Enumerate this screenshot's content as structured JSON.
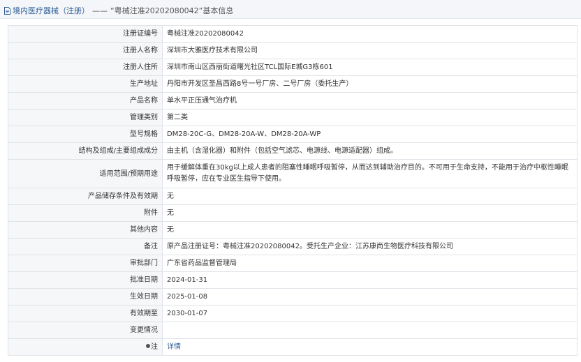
{
  "breadcrumb": {
    "section": "境内医疗器械（注册）",
    "separator": "——",
    "current": "“粤械注准20202080042”基本信息"
  },
  "rows": [
    {
      "label": "注册证编号",
      "value": "粤械注准20202080042"
    },
    {
      "label": "注册人名称",
      "value": "深圳市大雅医疗技术有限公司"
    },
    {
      "label": "注册人住所",
      "value": "深圳市南山区西丽街道曙光社区TCL国际E城G3栋601"
    },
    {
      "label": "生产地址",
      "value": "丹阳市开发区圣昌西路8号一号厂房、二号厂房（委托生产）"
    },
    {
      "label": "产品名称",
      "value": "单水平正压通气治疗机"
    },
    {
      "label": "管理类别",
      "value": "第二类"
    },
    {
      "label": "型号规格",
      "value": "DM28-20C-G、DM28-20A-W、DM28-20A-WP"
    },
    {
      "label": "结构及组成/主要组成成分",
      "value": "由主机（含湿化器）和附件（包括空气滤芯、电源线、电源适配器）组成。"
    },
    {
      "label": "适用范围/预期用途",
      "value": "用于缓解体重在30kg以上成人患者的阻塞性睡眠呼吸暂停，从而达到辅助治疗目的。不可用于生命支持，不能用于治疗中枢性睡眠呼吸暂停，应在专业医生指导下使用。"
    },
    {
      "label": "产品储存条件及有效期",
      "value": "无"
    },
    {
      "label": "附件",
      "value": "无"
    },
    {
      "label": "其他内容",
      "value": "无"
    },
    {
      "label": "备注",
      "value": "原产品注册证号：粤械注准20202080042。受托生产企业：江苏康尚生物医疗科技有限公司"
    },
    {
      "label": "审批部门",
      "value": "广东省药品监督管理局"
    },
    {
      "label": "批准日期",
      "value": "2024-01-31"
    },
    {
      "label": "生效日期",
      "value": "2025-01-08"
    },
    {
      "label": "有效期至",
      "value": "2030-01-07"
    },
    {
      "label": "变更情况",
      "value": ""
    }
  ],
  "note": {
    "label": "注",
    "link": "详情"
  },
  "icons": {
    "doc": "document-icon",
    "bullet": "bullet-dot-icon"
  },
  "colors": {
    "link": "#2d5d94",
    "label_bg": "#f6f7f9",
    "border": "#dfe3e8"
  }
}
